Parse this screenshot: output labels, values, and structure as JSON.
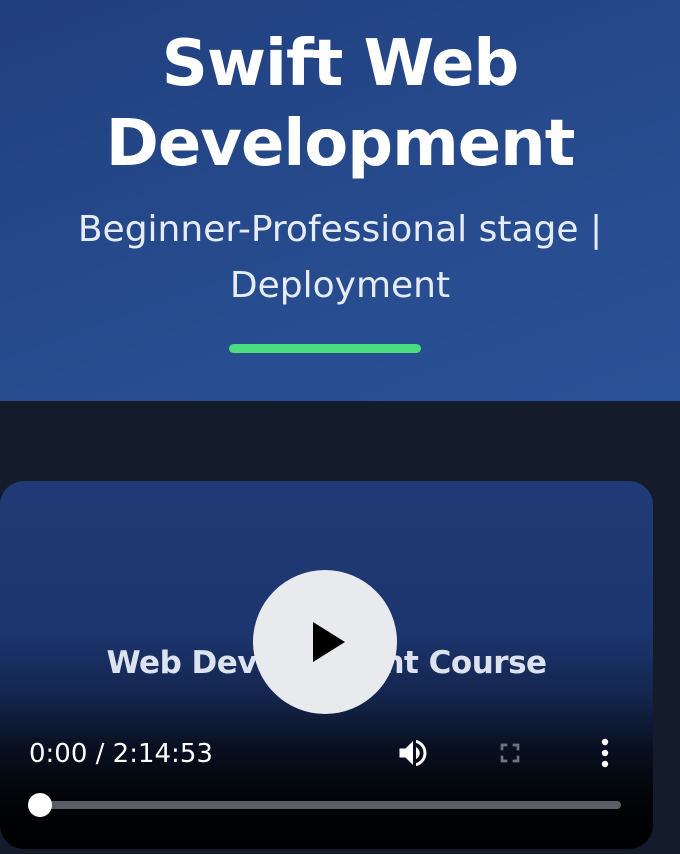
{
  "hero": {
    "title_lines": [
      "Swift Web",
      "Development"
    ],
    "subtitle_lines": [
      "Beginner-Professional stage |",
      "Deployment"
    ],
    "accent_color": "#4ade80"
  },
  "player": {
    "video_title": "Web Development Course",
    "time": "0:00 / 2:14:53",
    "current_time": "0:00",
    "duration": "2:14:53",
    "progress_fraction": 0,
    "controls": {
      "play_icon": "play-icon",
      "volume_icon": "volume-icon",
      "fullscreen_icon": "fullscreen-icon",
      "more_icon": "more-vertical-icon"
    }
  }
}
